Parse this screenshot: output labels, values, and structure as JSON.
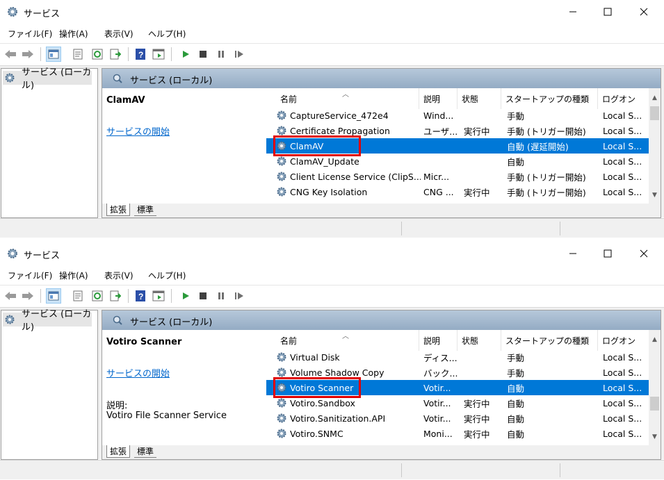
{
  "windows": [
    {
      "title": "サービス",
      "menu": [
        "ファイル(F)",
        "操作(A)",
        "表示(V)",
        "ヘルプ(H)"
      ],
      "tree_item": "サービス (ローカル)",
      "pane_title": "サービス (ローカル)",
      "selected_service": "ClamAV",
      "start_link": "サービスの開始",
      "description_label": "",
      "description_text": "",
      "columns": [
        "名前",
        "説明",
        "状態",
        "スタートアップの種類",
        "ログオン"
      ],
      "rows": [
        {
          "name": "CaptureService_472e4",
          "desc": "Wind...",
          "status": "",
          "startup": "手動",
          "logon": "Local S..."
        },
        {
          "name": "Certificate Propagation",
          "desc": "ユーザ...",
          "status": "実行中",
          "startup": "手動 (トリガー開始)",
          "logon": "Local S..."
        },
        {
          "name": "ClamAV",
          "desc": "",
          "status": "",
          "startup": "自動 (遅延開始)",
          "logon": "Local S...",
          "selected": true
        },
        {
          "name": "ClamAV_Update",
          "desc": "",
          "status": "",
          "startup": "自動",
          "logon": "Local S..."
        },
        {
          "name": "Client License Service (ClipS...",
          "desc": "Micr...",
          "status": "",
          "startup": "手動 (トリガー開始)",
          "logon": "Local S..."
        },
        {
          "name": "CNG Key Isolation",
          "desc": "CNG ...",
          "status": "実行中",
          "startup": "手動 (トリガー開始)",
          "logon": "Local S..."
        }
      ],
      "tabs": [
        "拡張",
        "標準"
      ]
    },
    {
      "title": "サービス",
      "menu": [
        "ファイル(F)",
        "操作(A)",
        "表示(V)",
        "ヘルプ(H)"
      ],
      "tree_item": "サービス (ローカル)",
      "pane_title": "サービス (ローカル)",
      "selected_service": "Votiro Scanner",
      "start_link": "サービスの開始",
      "description_label": "説明:",
      "description_text": "Votiro File Scanner Service",
      "columns": [
        "名前",
        "説明",
        "状態",
        "スタートアップの種類",
        "ログオン"
      ],
      "rows": [
        {
          "name": "Virtual Disk",
          "desc": "ディス...",
          "status": "",
          "startup": "手動",
          "logon": "Local S..."
        },
        {
          "name": "Volume Shadow Copy",
          "desc": "バック...",
          "status": "",
          "startup": "手動",
          "logon": "Local S..."
        },
        {
          "name": "Votiro Scanner",
          "desc": "Votir...",
          "status": "",
          "startup": "自動",
          "logon": "Local S...",
          "selected": true
        },
        {
          "name": "Votiro.Sandbox",
          "desc": "Votir...",
          "status": "実行中",
          "startup": "自動",
          "logon": "Local S..."
        },
        {
          "name": "Votiro.Sanitization.API",
          "desc": "Votir...",
          "status": "実行中",
          "startup": "自動",
          "logon": "Local S..."
        },
        {
          "name": "Votiro.SNMC",
          "desc": "Moni...",
          "status": "実行中",
          "startup": "自動",
          "logon": "Local S..."
        }
      ],
      "tabs": [
        "拡張",
        "標準"
      ]
    }
  ],
  "icons": {
    "app": "gear-icon",
    "service": "gear-icon",
    "back": "arrow-left-icon",
    "forward": "arrow-right-icon",
    "play": "play-icon",
    "stop": "stop-icon",
    "pause": "pause-icon",
    "restart": "restart-icon",
    "help": "help-icon"
  },
  "colors": {
    "selection": "#0078d7",
    "highlight_box": "#e00000",
    "link": "#0066cc",
    "header": "#9eb6ce"
  }
}
